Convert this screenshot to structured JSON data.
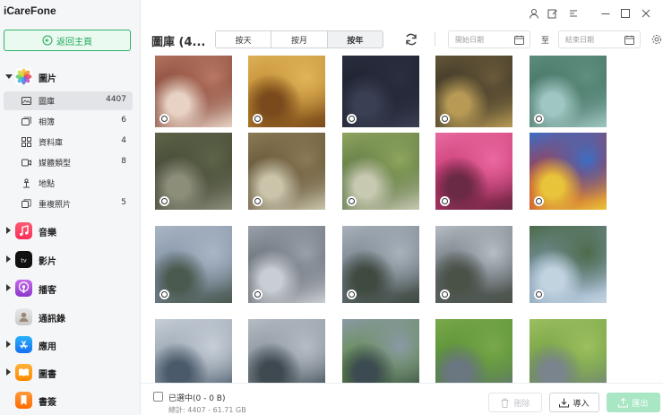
{
  "app": {
    "title": "iCareFone"
  },
  "sidebar": {
    "home_button": "返回主頁",
    "categories": [
      {
        "label": "圖片",
        "icon": "photos-icon",
        "expanded": true,
        "color": "#ff9f0a"
      },
      {
        "label": "音樂",
        "icon": "music-icon",
        "color": "#fa2d55"
      },
      {
        "label": "影片",
        "icon": "appletv-icon",
        "color": "#111111"
      },
      {
        "label": "播客",
        "icon": "podcast-icon",
        "color": "#9b41d8"
      },
      {
        "label": "通訊錄",
        "icon": "contacts-icon",
        "color": "#cccccc"
      },
      {
        "label": "應用",
        "icon": "appstore-icon",
        "color": "#1b8cf5"
      },
      {
        "label": "圖書",
        "icon": "books-icon",
        "color": "#ff8a00"
      },
      {
        "label": "書簽",
        "icon": "bookmark-icon",
        "color": "#ff7a00"
      }
    ],
    "photo_items": [
      {
        "label": "圖庫",
        "count": "4407",
        "icon": "image-icon",
        "active": true
      },
      {
        "label": "相簿",
        "count": "6",
        "icon": "album-icon"
      },
      {
        "label": "資料庫",
        "count": "4",
        "icon": "library-icon"
      },
      {
        "label": "媒體類型",
        "count": "8",
        "icon": "media-type-icon"
      },
      {
        "label": "地點",
        "count": "",
        "icon": "location-pin-icon"
      },
      {
        "label": "重複照片",
        "count": "5",
        "icon": "duplicate-icon"
      }
    ]
  },
  "header": {
    "title": "圖庫 (4...",
    "tabs": [
      {
        "label": "按天"
      },
      {
        "label": "按月"
      },
      {
        "label": "按年",
        "active": true
      }
    ],
    "start_date_placeholder": "開始日期",
    "end_date_placeholder": "結束日期",
    "to_label": "至"
  },
  "photos": [
    {
      "scene": "meat",
      "colors": [
        "#7a3b2c",
        "#b87865",
        "#e8d2c4"
      ]
    },
    {
      "scene": "pizza",
      "colors": [
        "#b9852c",
        "#e1b45a",
        "#7a4a1d"
      ]
    },
    {
      "scene": "dark-screen",
      "colors": [
        "#1a1d2a",
        "#2b2f40",
        "#3a3f54"
      ]
    },
    {
      "scene": "night-street",
      "colors": [
        "#2d2a20",
        "#6a5a3a",
        "#b89a55"
      ]
    },
    {
      "scene": "lake",
      "colors": [
        "#3f6d5f",
        "#5f8f7f",
        "#9fc6c2"
      ]
    },
    {
      "scene": "fountain",
      "colors": [
        "#3c4030",
        "#5e6448",
        "#8c8e7a"
      ]
    },
    {
      "scene": "pavilion",
      "colors": [
        "#5a4a30",
        "#8a7a55",
        "#c9c4aa"
      ]
    },
    {
      "scene": "vending",
      "colors": [
        "#4f6a3a",
        "#8fa55f",
        "#c7c9b0"
      ]
    },
    {
      "scene": "flowers",
      "colors": [
        "#c2316a",
        "#e96aa0",
        "#6a2a45"
      ]
    },
    {
      "scene": "mask",
      "colors": [
        "#c4302e",
        "#3b6ec4",
        "#e8c43a"
      ]
    },
    {
      "scene": "city-river",
      "colors": [
        "#7a8aa0",
        "#a9b6c4",
        "#4b5a4e"
      ]
    },
    {
      "scene": "bridge-arch",
      "colors": [
        "#5a6068",
        "#9aa1aa",
        "#c9ced4"
      ]
    },
    {
      "scene": "bridge-river",
      "colors": [
        "#6c7680",
        "#a9b2bb",
        "#3f4a40"
      ]
    },
    {
      "scene": "bridge-reflection",
      "colors": [
        "#5f666e",
        "#b6bdc4",
        "#4a5248"
      ]
    },
    {
      "scene": "park-river",
      "colors": [
        "#7f9ab3",
        "#4d6b4a",
        "#c2d3e0"
      ]
    },
    {
      "scene": "cloudy-harbor",
      "colors": [
        "#8c98a6",
        "#c6ced6",
        "#4a5a6a"
      ]
    },
    {
      "scene": "cloudy-town",
      "colors": [
        "#7e8892",
        "#b5bcc4",
        "#3e4a50"
      ]
    },
    {
      "scene": "pigeons",
      "colors": [
        "#5b8a3a",
        "#8a9aa6",
        "#3c4a52"
      ]
    },
    {
      "scene": "pigeons-grass",
      "colors": [
        "#4f8a2f",
        "#79a84a",
        "#6a7680"
      ]
    },
    {
      "scene": "pigeon-field",
      "colors": [
        "#6a9a3c",
        "#9cbf60",
        "#7a848c"
      ]
    }
  ],
  "footer": {
    "selection": "已選中(0 - 0 B)",
    "total": "總計: 4407 - 61.71 GB",
    "delete": "刪除",
    "import": "導入",
    "export": "匯出"
  },
  "accent_color": "#22a85a"
}
